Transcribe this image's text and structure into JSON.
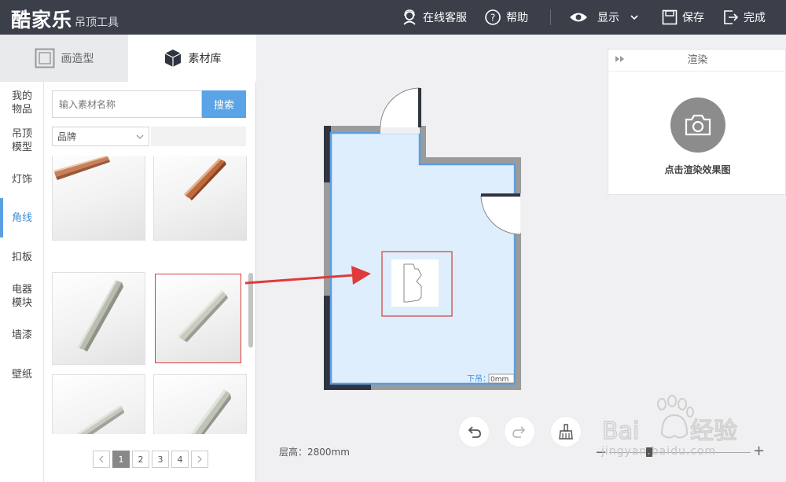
{
  "topbar": {
    "brand": "酷家乐",
    "brand_sub": "吊顶工具",
    "service_label": "在线客服",
    "help_label": "帮助",
    "display_label": "显示",
    "save_label": "保存",
    "finish_label": "完成"
  },
  "tabs": {
    "shape_label": "画造型",
    "material_label": "素材库"
  },
  "categories": [
    {
      "label": "我的\n物品"
    },
    {
      "label": "吊顶\n模型"
    },
    {
      "label": "灯饰"
    },
    {
      "label": "角线"
    },
    {
      "label": "扣板"
    },
    {
      "label": "电器\n模块"
    },
    {
      "label": "墙漆"
    },
    {
      "label": "壁纸"
    }
  ],
  "active_category": "角线",
  "search": {
    "placeholder": "输入素材名称",
    "button_label": "搜索"
  },
  "filter": {
    "brand_value": "品牌"
  },
  "pagination": {
    "pages": [
      "1",
      "2",
      "3",
      "4"
    ],
    "current": "1"
  },
  "canvas": {
    "drop_label": "下吊：",
    "drop_value": "0mm",
    "floor_height": "层高：2800mm"
  },
  "render": {
    "title": "渲染",
    "button_label": "点击渲染效果图"
  },
  "watermark": {
    "text": "jingyan.baidu.com"
  },
  "colors": {
    "topbar_bg": "#3a3f4a",
    "accent": "#5aa3e6",
    "room_fill": "#dfeefd",
    "room_border": "#5b9ee0",
    "selection_red": "#e03a3a"
  }
}
